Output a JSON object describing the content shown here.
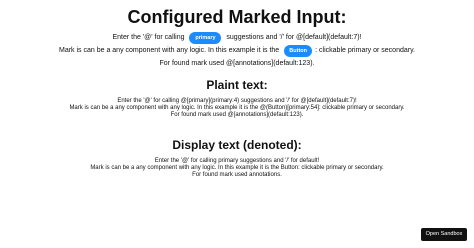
{
  "main_title": "Configured Marked Input:",
  "marked_input": {
    "line1_before": "Enter the '@' for calling ",
    "pill_primary": "primary",
    "line1_after": " suggestions and '/' for @[default](default:7)!",
    "line2_before": "Mark is can be a any component with any logic. In this example it is the ",
    "pill_button": "Button",
    "line2_after": ": clickable primary or secondary.",
    "line3": "For found mark used @[annotations](default:123)."
  },
  "plain_section": {
    "title": "Plaint text:",
    "line1": "Enter the '@' for calling @[primary](primary:4) suggestions and '/' for @[default](default:7)!",
    "line2": "Mark is can be a any component with any logic. In this example it is the @(Button)[primary:54]: clickable primary or secondary.",
    "line3": "For found mark used @[annotations](default:123)."
  },
  "display_section": {
    "title": "Display text (denoted):",
    "line1": "Enter the '@' for calling primary suggestions and '/' for default!",
    "line2": "Mark is can be a any component with any logic. In this example it is the Button: clickable primary or secondary.",
    "line3": "For found mark used annotations."
  },
  "sandbox_button": "Open Sandbox",
  "colors": {
    "pill": "#1a8cff",
    "sandbox_button_bg": "#111111"
  }
}
